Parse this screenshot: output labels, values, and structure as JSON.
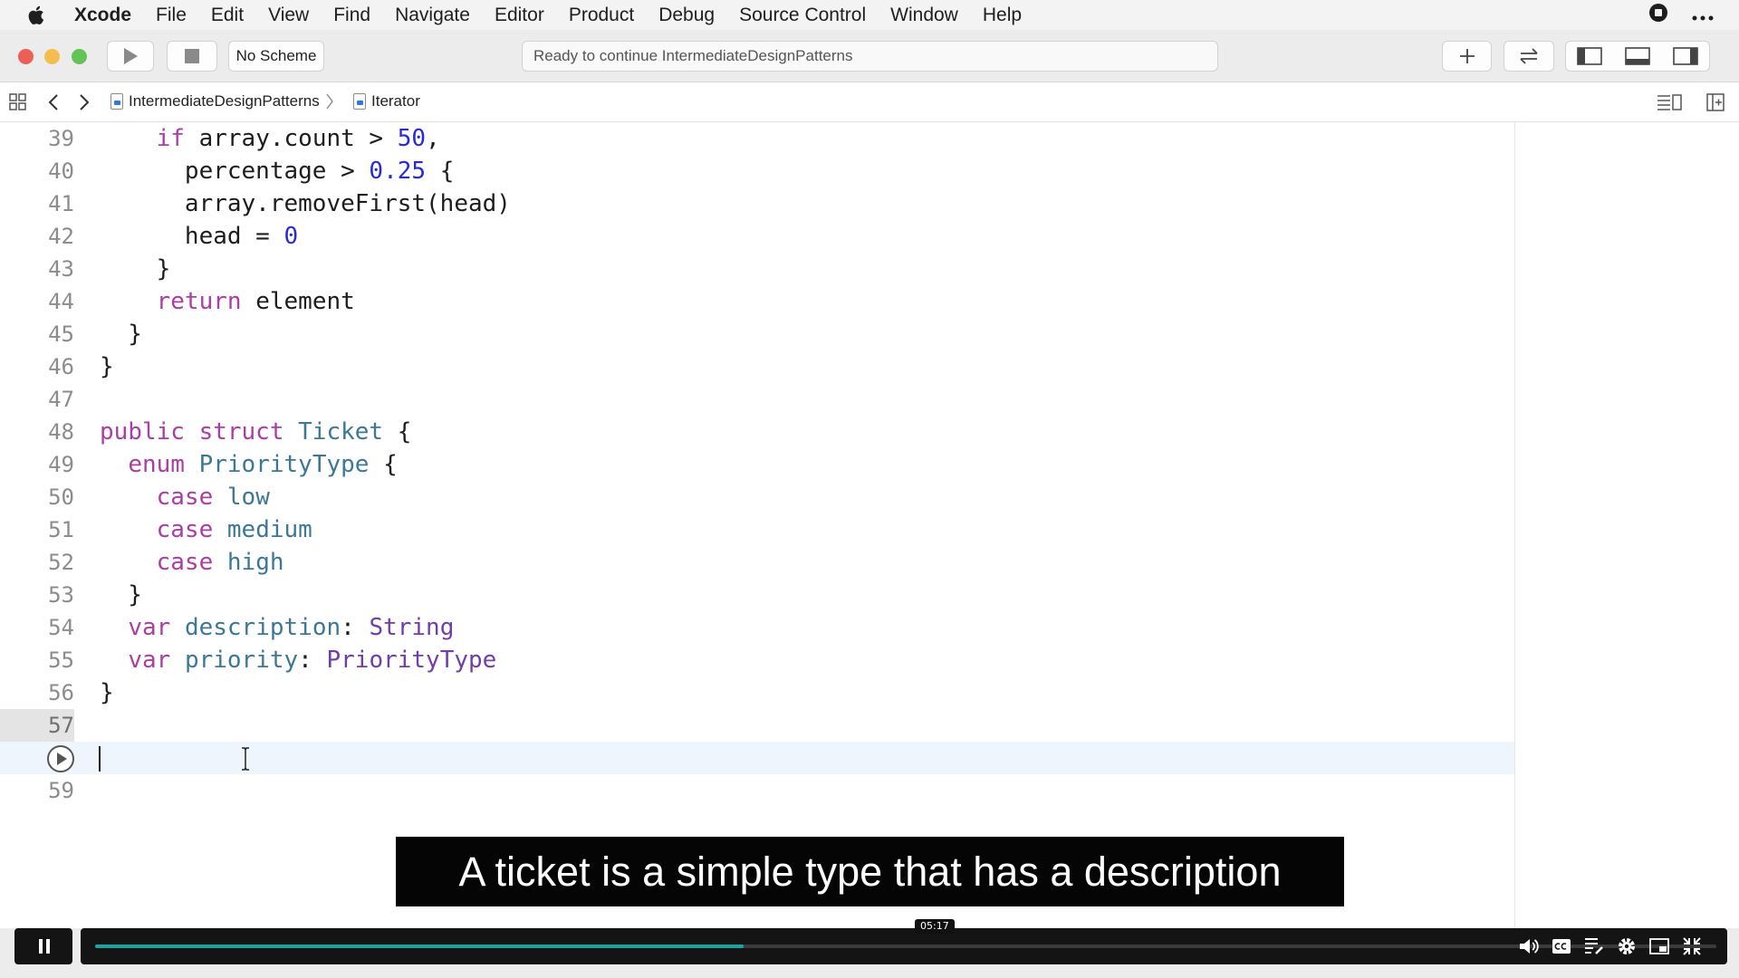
{
  "menubar": {
    "app_name": "Xcode",
    "items": [
      "File",
      "Edit",
      "View",
      "Find",
      "Navigate",
      "Editor",
      "Product",
      "Debug",
      "Source Control",
      "Window",
      "Help"
    ]
  },
  "toolbar": {
    "scheme": "No Scheme",
    "activity_status": "Ready to continue IntermediateDesignPatterns"
  },
  "jumpbar": {
    "breadcrumbs": [
      "IntermediateDesignPatterns",
      "Iterator"
    ]
  },
  "editor": {
    "current_line": 58,
    "lines": [
      {
        "n": "39",
        "code": "    if array.count > 50,"
      },
      {
        "n": "40",
        "code": "      percentage > 0.25 {"
      },
      {
        "n": "41",
        "code": "      array.removeFirst(head)"
      },
      {
        "n": "42",
        "code": "      head = 0"
      },
      {
        "n": "43",
        "code": "    }"
      },
      {
        "n": "44",
        "code": "    return element"
      },
      {
        "n": "45",
        "code": "  }"
      },
      {
        "n": "46",
        "code": "}"
      },
      {
        "n": "47",
        "code": ""
      },
      {
        "n": "48",
        "code": "public struct Ticket {"
      },
      {
        "n": "49",
        "code": "  enum PriorityType {"
      },
      {
        "n": "50",
        "code": "    case low"
      },
      {
        "n": "51",
        "code": "    case medium"
      },
      {
        "n": "52",
        "code": "    case high"
      },
      {
        "n": "53",
        "code": "  }"
      },
      {
        "n": "54",
        "code": "  var description: String"
      },
      {
        "n": "55",
        "code": "  var priority: PriorityType"
      },
      {
        "n": "56",
        "code": "}"
      },
      {
        "n": "57",
        "code": ""
      },
      {
        "n": "",
        "code": ""
      },
      {
        "n": "59",
        "code": ""
      }
    ]
  },
  "caption": {
    "text": "A ticket is a simple type that has a description"
  },
  "video": {
    "timecode": "05:17",
    "progress": 0.4
  },
  "colors": {
    "keyword": "#ad3da4",
    "type": "#703daa",
    "identifier": "#3c7896",
    "number": "#272ad8",
    "progress_fill": "#1aa3a0"
  }
}
